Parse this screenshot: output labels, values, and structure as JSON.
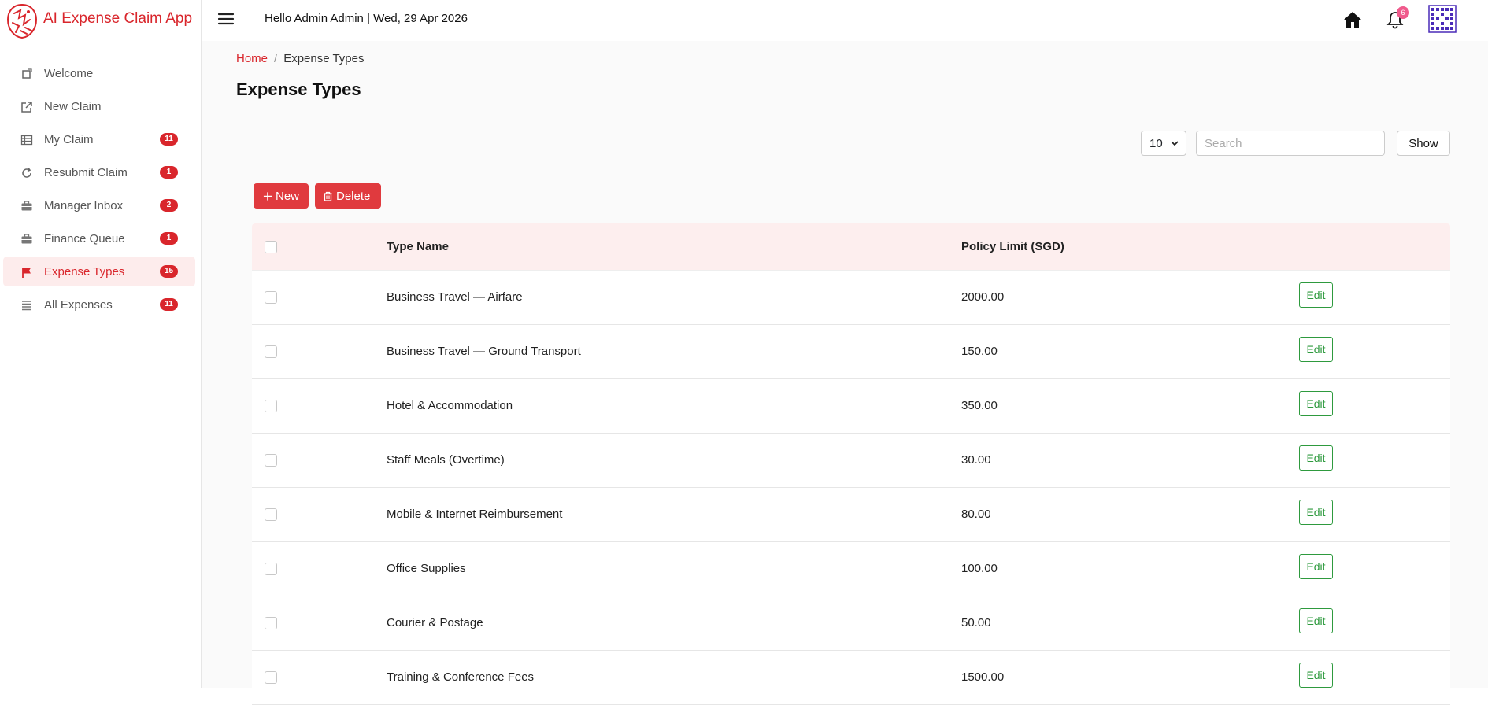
{
  "app": {
    "title": "AI Expense Claim App"
  },
  "header": {
    "greeting": "Hello Admin Admin | Wed, 29 Apr 2026",
    "notification_count": "6"
  },
  "sidebar": {
    "items": [
      {
        "label": "Welcome",
        "icon": "square-icon",
        "badge": ""
      },
      {
        "label": "New Claim",
        "icon": "external-link-icon",
        "badge": ""
      },
      {
        "label": "My Claim",
        "icon": "table-icon",
        "badge": "11"
      },
      {
        "label": "Resubmit Claim",
        "icon": "refresh-icon",
        "badge": "1"
      },
      {
        "label": "Manager Inbox",
        "icon": "briefcase-icon",
        "badge": "2"
      },
      {
        "label": "Finance Queue",
        "icon": "briefcase-icon",
        "badge": "1"
      },
      {
        "label": "Expense Types",
        "icon": "flag-icon",
        "badge": "15"
      },
      {
        "label": "All Expenses",
        "icon": "list-icon",
        "badge": "11"
      }
    ],
    "active_index": 6
  },
  "breadcrumb": {
    "home": "Home",
    "separator": "/",
    "current": "Expense Types"
  },
  "page": {
    "title": "Expense Types"
  },
  "toolbar": {
    "page_size": "10",
    "search_placeholder": "Search",
    "show_label": "Show",
    "new_label": "New",
    "delete_label": "Delete"
  },
  "table": {
    "columns": [
      "Type Name",
      "Policy Limit (SGD)"
    ],
    "edit_label": "Edit",
    "rows": [
      {
        "name": "Business Travel — Airfare",
        "limit": "2000.00"
      },
      {
        "name": "Business Travel — Ground Transport",
        "limit": "150.00"
      },
      {
        "name": "Hotel & Accommodation",
        "limit": "350.00"
      },
      {
        "name": "Staff Meals (Overtime)",
        "limit": "30.00"
      },
      {
        "name": "Mobile & Internet Reimbursement",
        "limit": "80.00"
      },
      {
        "name": "Office Supplies",
        "limit": "100.00"
      },
      {
        "name": "Courier & Postage",
        "limit": "50.00"
      },
      {
        "name": "Training & Conference Fees",
        "limit": "1500.00"
      }
    ]
  },
  "colors": {
    "accent": "#d9262c",
    "button": "#e03a3e",
    "edit": "#2e9a3e",
    "header_row": "#fdeeee"
  }
}
